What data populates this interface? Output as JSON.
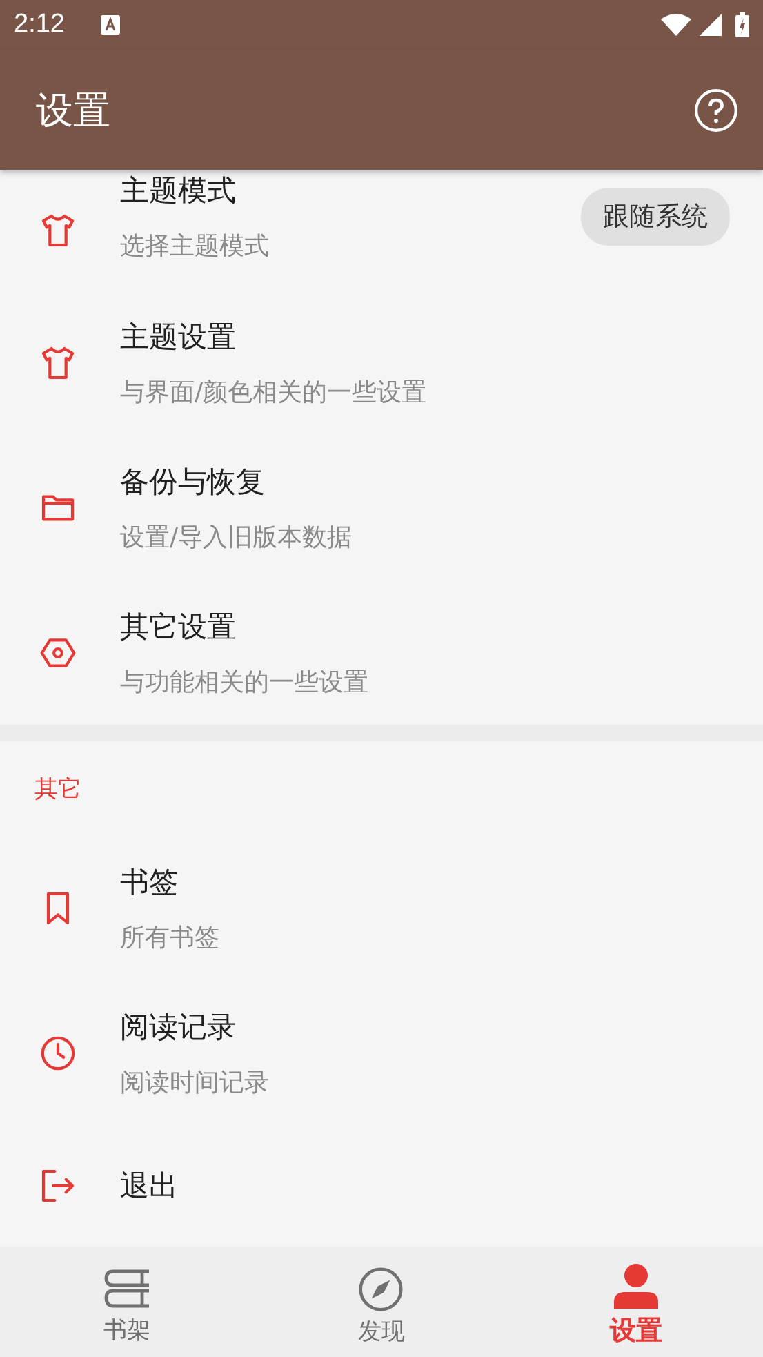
{
  "status_bar": {
    "time": "2:12"
  },
  "app_bar": {
    "title": "设置"
  },
  "settings": [
    {
      "title": "主题模式",
      "subtitle": "选择主题模式",
      "value": "跟随系统"
    },
    {
      "title": "主题设置",
      "subtitle": "与界面/颜色相关的一些设置"
    },
    {
      "title": "备份与恢复",
      "subtitle": "设置/导入旧版本数据"
    },
    {
      "title": "其它设置",
      "subtitle": "与功能相关的一些设置"
    }
  ],
  "other_section": {
    "header": "其它",
    "items": [
      {
        "title": "书签",
        "subtitle": "所有书签"
      },
      {
        "title": "阅读记录",
        "subtitle": "阅读时间记录"
      },
      {
        "title": "退出"
      }
    ]
  },
  "bottom_nav": [
    {
      "label": "书架",
      "selected": false
    },
    {
      "label": "发现",
      "selected": false
    },
    {
      "label": "设置",
      "selected": true
    }
  ]
}
